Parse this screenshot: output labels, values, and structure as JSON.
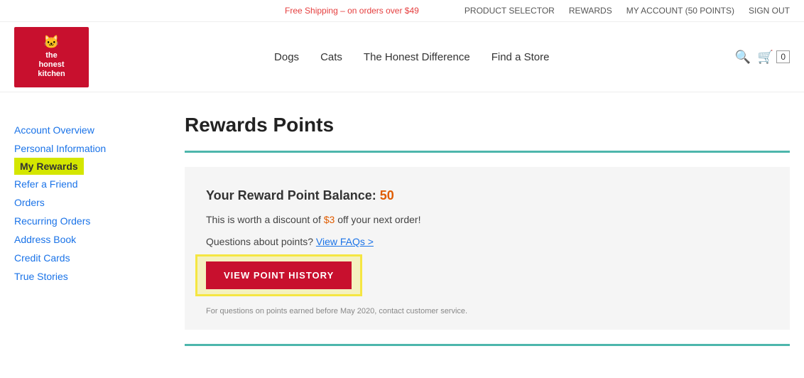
{
  "topbar": {
    "shipping": "Free Shipping – on orders over $49",
    "nav": {
      "product_selector": "PRODUCT SELECTOR",
      "rewards": "REWARDS",
      "my_account": "MY ACCOUNT",
      "points_label": "50 POINTS",
      "sign_out": "SIGN OUT"
    }
  },
  "logo": {
    "line1": "the",
    "line2": "honest",
    "line3": "kitchen",
    "animal": "🐱"
  },
  "main_nav": {
    "items": [
      {
        "label": "Dogs"
      },
      {
        "label": "Cats"
      },
      {
        "label": "The Honest Difference"
      },
      {
        "label": "Find a Store"
      }
    ]
  },
  "sidebar": {
    "items": [
      {
        "label": "Account Overview",
        "active": false
      },
      {
        "label": "Personal Information",
        "active": false
      },
      {
        "label": "My Rewards",
        "active": true
      },
      {
        "label": "Refer a Friend",
        "active": false
      },
      {
        "label": "Orders",
        "active": false
      },
      {
        "label": "Recurring Orders",
        "active": false
      },
      {
        "label": "Address Book",
        "active": false
      },
      {
        "label": "Credit Cards",
        "active": false
      },
      {
        "label": "True Stories",
        "active": false
      }
    ]
  },
  "main": {
    "page_title": "Rewards Points",
    "balance_label": "Your Reward Point Balance:",
    "balance_value": "50",
    "discount_text": "This is worth a discount of",
    "discount_amount": "$3",
    "discount_suffix": "off your next order!",
    "faq_text": "Questions about points?",
    "faq_link": "View FAQs >",
    "view_btn_label": "VIEW POINT HISTORY",
    "disclaimer": "For questions on points earned before May 2020, contact customer service."
  },
  "icons": {
    "search": "🔍",
    "cart": "🛒",
    "cart_count": "0"
  }
}
